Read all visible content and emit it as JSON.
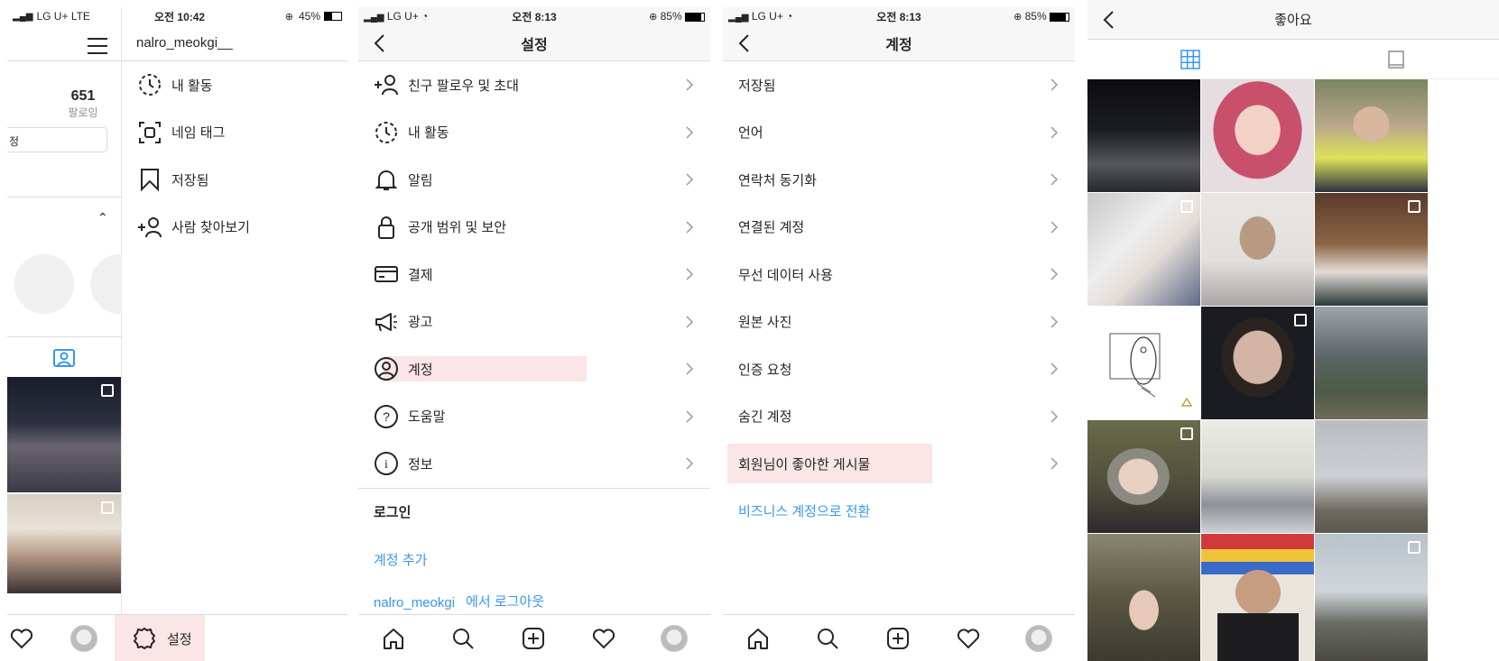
{
  "s1": {
    "status": {
      "left": "LG U+  LTE",
      "time": "오전 10:42",
      "battery": "45%"
    },
    "username": "nalro_meokgi__",
    "stat_count": "651",
    "stat_label": "팔로잉",
    "edit_fragment": "정",
    "menu": [
      {
        "label": "내 활동"
      },
      {
        "label": "네임 태그"
      },
      {
        "label": "저장됨"
      },
      {
        "label": "사람 찾아보기"
      }
    ],
    "settings_label": "설정"
  },
  "s2": {
    "status": {
      "left": "LG U+",
      "time": "오전 8:13",
      "battery": "85%"
    },
    "title": "설정",
    "items": [
      {
        "label": "친구 팔로우 및 초대"
      },
      {
        "label": "내 활동"
      },
      {
        "label": "알림"
      },
      {
        "label": "공개 범위 및 보안"
      },
      {
        "label": "결제"
      },
      {
        "label": "광고"
      },
      {
        "label": "계정"
      },
      {
        "label": "도움말"
      },
      {
        "label": "정보"
      }
    ],
    "login_header": "로그인",
    "add_account": "계정 추가",
    "logout_user": "nalro_meokgi",
    "logout_text": "에서 로그아웃"
  },
  "s3": {
    "status": {
      "left": "LG U+",
      "time": "오전 8:13",
      "battery": "85%"
    },
    "title": "계정",
    "items": [
      {
        "label": "저장됨"
      },
      {
        "label": "언어"
      },
      {
        "label": "연락처 동기화"
      },
      {
        "label": "연결된 계정"
      },
      {
        "label": "무선 데이터 사용"
      },
      {
        "label": "원본 사진"
      },
      {
        "label": "인증 요청"
      },
      {
        "label": "숨긴 계정"
      },
      {
        "label": "회원님이 좋아한 게시물"
      }
    ],
    "business": "비즈니스 계정으로 전환"
  },
  "s4": {
    "title": "좋아요",
    "accent": "#3897f0"
  },
  "colors": {
    "highlight": "#fbe5e6",
    "link": "#3897f0",
    "divider": "#dbdbdb"
  }
}
